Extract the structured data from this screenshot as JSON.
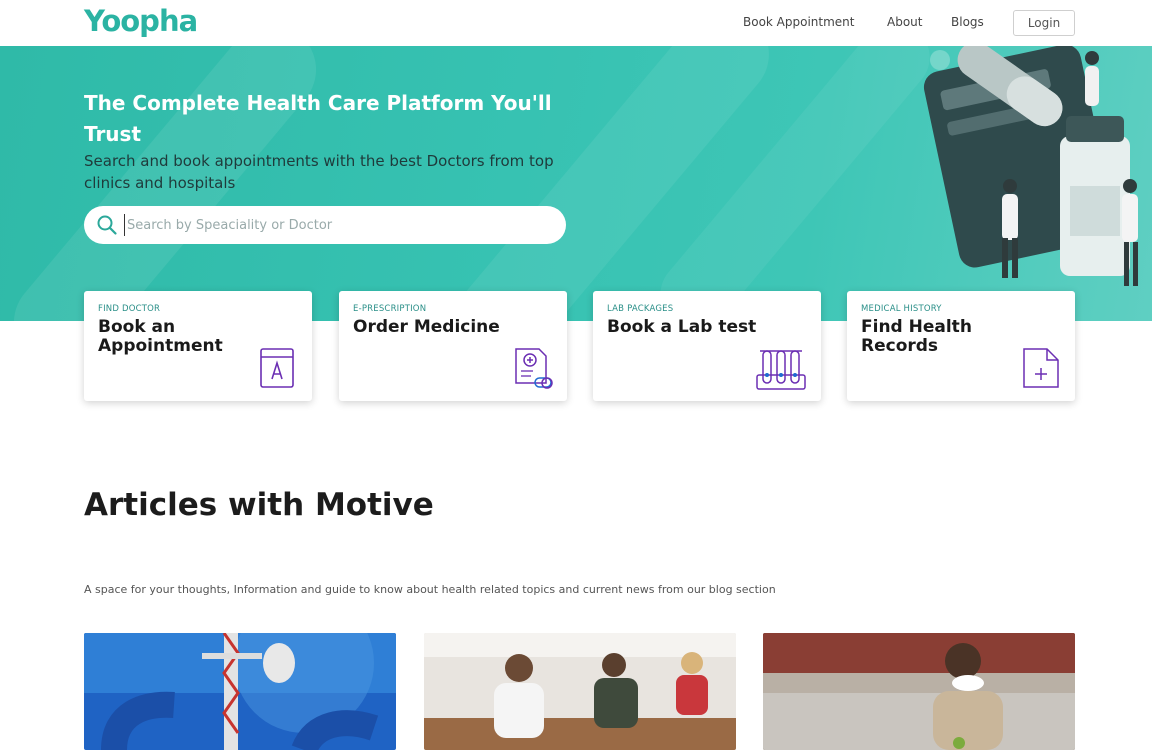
{
  "nav": {
    "logo": "Yoopha",
    "links": [
      "Book Appointment",
      "About",
      "Blogs"
    ],
    "login": "Login"
  },
  "hero": {
    "title": "The Complete Health Care Platform You'll Trust",
    "subtitle": "Search and book appointments with the best Doctors from top clinics and hospitals",
    "search_placeholder": "Search by Speaciality or Doctor"
  },
  "cards": [
    {
      "tag": "FIND DOCTOR",
      "title": "Book an Appointment",
      "icon": "appointment-book-icon"
    },
    {
      "tag": "E-PRESCRIPTION",
      "title": "Order Medicine",
      "icon": "prescription-icon"
    },
    {
      "tag": "LAB PACKAGES",
      "title": "Book a Lab test",
      "icon": "test-tubes-icon"
    },
    {
      "tag": "MEDICAL HISTORY",
      "title": "Find Health Records",
      "icon": "add-document-icon"
    }
  ],
  "articles": {
    "heading": "Articles with Motive",
    "description": "A space for your thoughts, Information and guide to know about health related topics and current news from our blog section",
    "items": [
      {
        "image": "5g-tower-image"
      },
      {
        "image": "yoga-class-image"
      },
      {
        "image": "masked-shopper-image"
      }
    ]
  },
  "colors": {
    "accent": "#2bb3a3",
    "icon": "#6b2fb3",
    "hero": "#37c2b2"
  }
}
